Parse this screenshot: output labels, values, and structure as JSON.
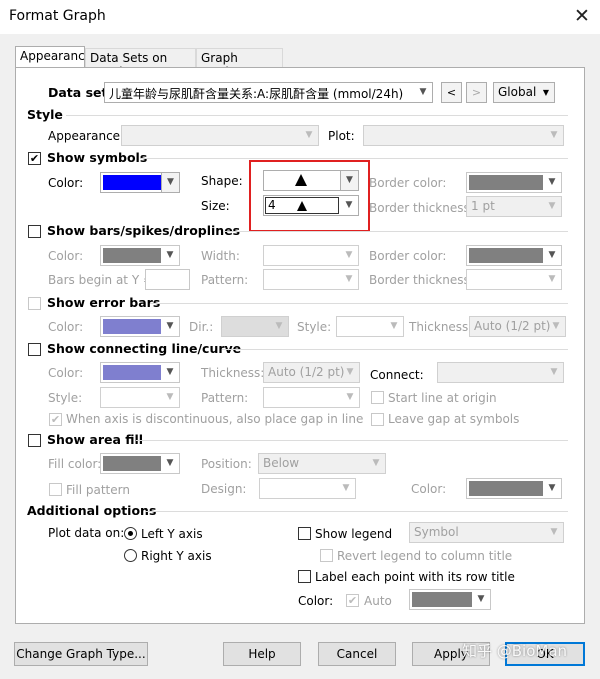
{
  "window": {
    "title": "Format Graph",
    "close_glyph": "✕"
  },
  "tabs": [
    {
      "label": "Appearance",
      "active": true
    },
    {
      "label": "Data Sets on Graph",
      "active": false
    },
    {
      "label": "Graph Settings",
      "active": false
    }
  ],
  "dataset": {
    "label": "Data set:",
    "value": "儿童年龄与尿肌酐含量关系:A:尿肌酐含量 (mmol/24h)",
    "prev": "<",
    "next": ">",
    "scope": "Global"
  },
  "style": {
    "heading": "Style",
    "appearance_label": "Appearance:",
    "plot_label": "Plot:"
  },
  "symbols": {
    "heading": "Show symbols",
    "checked": true,
    "color_label": "Color:",
    "color": "#0000ff",
    "shape_label": "Shape:",
    "size_label": "Size:",
    "size_value": "4",
    "border_color_label": "Border color:",
    "border_color": "#808080",
    "border_thickness_label": "Border thickness:",
    "border_thickness_value": "1 pt"
  },
  "bars": {
    "heading": "Show bars/spikes/droplines",
    "color_label": "Color:",
    "width_label": "Width:",
    "border_color_label": "Border color:",
    "border_color": "#808080",
    "begin_label": "Bars begin at Y =",
    "pattern_label": "Pattern:",
    "border_thickness_label": "Border thickness:"
  },
  "error_bars": {
    "heading": "Show error bars",
    "color_label": "Color:",
    "color": "#7f7fcf",
    "dir_label": "Dir.:",
    "style_label": "Style:",
    "thickness_label": "Thickness:",
    "thickness_value": "Auto (1/2 pt)"
  },
  "connecting": {
    "heading": "Show connecting line/curve",
    "color_label": "Color:",
    "color": "#7f7fcf",
    "thickness_label": "Thickness:",
    "thickness_value": "Auto (1/2 pt)",
    "connect_label": "Connect:",
    "style_label": "Style:",
    "pattern_label": "Pattern:",
    "start_origin": "Start line at origin",
    "gap_discontinuous": "When axis is discontinuous, also place gap in line",
    "leave_gap": "Leave gap at symbols"
  },
  "area_fill": {
    "heading": "Show area fill",
    "fill_color_label": "Fill color:",
    "fill_color": "#808080",
    "position_label": "Position:",
    "position_value": "Below",
    "fill_pattern": "Fill pattern",
    "design_label": "Design:",
    "color_label": "Color:",
    "color": "#808080"
  },
  "additional": {
    "heading": "Additional options",
    "plot_on_label": "Plot data on:",
    "left_axis": "Left Y axis",
    "right_axis": "Right  Y axis",
    "show_legend": "Show legend",
    "legend_value": "Symbol",
    "revert_legend": "Revert legend to column title",
    "label_points": "Label each point with its row title",
    "color_label": "Color:",
    "auto_label": "Auto",
    "label_color": "#808080"
  },
  "buttons": {
    "change_type": "Change Graph Type...",
    "help": "Help",
    "cancel": "Cancel",
    "apply": "Apply",
    "ok": "OK"
  },
  "watermark": "知乎 @BioMan",
  "icons": {
    "dropdown": "chevron-down-icon",
    "check": "checkmark-icon",
    "triangle": "triangle-symbol-icon"
  }
}
